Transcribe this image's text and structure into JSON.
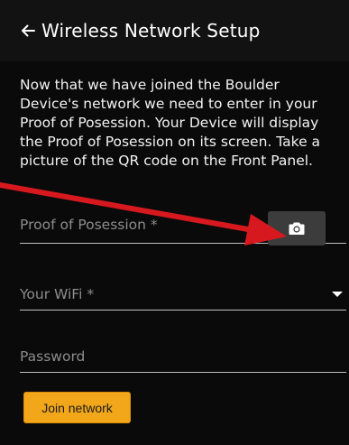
{
  "header": {
    "title": "Wireless Network Setup",
    "back_icon": "arrow-left-icon"
  },
  "intro_text": "Now that we have joined the Boulder Device's network we need to enter in your Proof of Posession. Your Device will display the Proof of Posession on its screen. Take a picture of the QR code on the Front Panel.",
  "form": {
    "proof_of_possession": {
      "placeholder": "Proof of Posession *",
      "camera_icon": "camera-icon"
    },
    "wifi": {
      "placeholder": "Your WiFi *",
      "caret_icon": "dropdown-caret-icon"
    },
    "password": {
      "placeholder": "Password"
    },
    "join_button_label": "Join network"
  },
  "colors": {
    "background": "#0a0a0a",
    "app_bar": "#121212",
    "accent": "#f2a71b",
    "annotation_arrow": "#d7191f",
    "camera_button": "#3c3c3c"
  }
}
